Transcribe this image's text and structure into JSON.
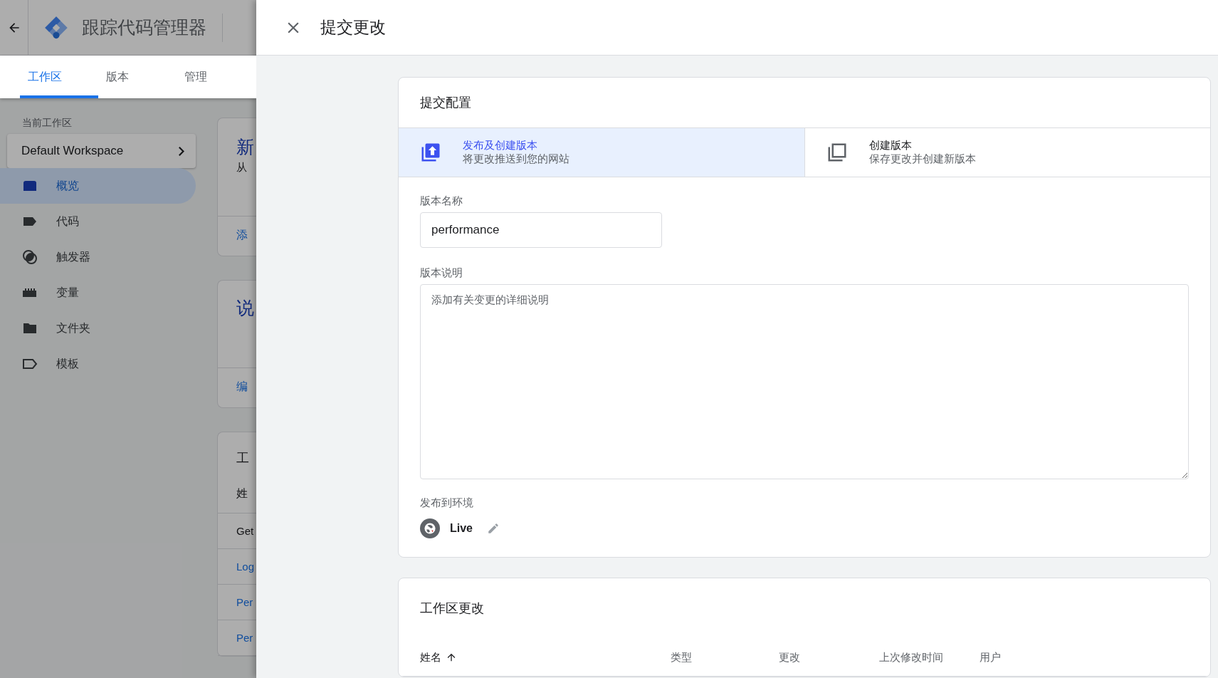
{
  "app": {
    "title": "跟踪代码管理器",
    "tabs": [
      {
        "label": "工作区",
        "selected": true
      },
      {
        "label": "版本",
        "selected": false
      },
      {
        "label": "管理",
        "selected": false
      }
    ],
    "workspace_label": "当前工作区",
    "workspace": "Default Workspace",
    "nav": [
      {
        "label": "概览",
        "selected": true
      },
      {
        "label": "代码",
        "selected": false
      },
      {
        "label": "触发器",
        "selected": false
      },
      {
        "label": "变量",
        "selected": false
      },
      {
        "label": "文件夹",
        "selected": false
      },
      {
        "label": "模板",
        "selected": false
      }
    ],
    "cards": [
      {
        "title": "新",
        "text": "从",
        "link": "添"
      },
      {
        "title": "说",
        "link": "编"
      },
      {
        "title": "工",
        "header": "姓",
        "rows": [
          {
            "text": "Get",
            "link": false
          },
          {
            "text": "Log",
            "link": true
          },
          {
            "text": "Per",
            "link": true
          },
          {
            "text": "Per",
            "link": true
          }
        ]
      }
    ]
  },
  "dialog": {
    "title": "提交更改",
    "config": {
      "title": "提交配置",
      "options": [
        {
          "title": "发布及创建版本",
          "subtitle": "将更改推送到您的网站",
          "selected": true
        },
        {
          "title": "创建版本",
          "subtitle": "保存更改并创建新版本",
          "selected": false
        }
      ],
      "version_name": {
        "label": "版本名称",
        "value": "performance"
      },
      "version_description": {
        "label": "版本说明",
        "placeholder": "添加有关变更的详细说明"
      },
      "environment": {
        "label": "发布到环境",
        "name": "Live"
      }
    },
    "changes": {
      "title": "工作区更改",
      "columns": [
        {
          "label": "姓名",
          "sorted": true
        },
        {
          "label": "类型",
          "sorted": false
        },
        {
          "label": "更改",
          "sorted": false
        },
        {
          "label": "上次修改时间",
          "sorted": false
        },
        {
          "label": "用户",
          "sorted": false
        }
      ]
    }
  }
}
